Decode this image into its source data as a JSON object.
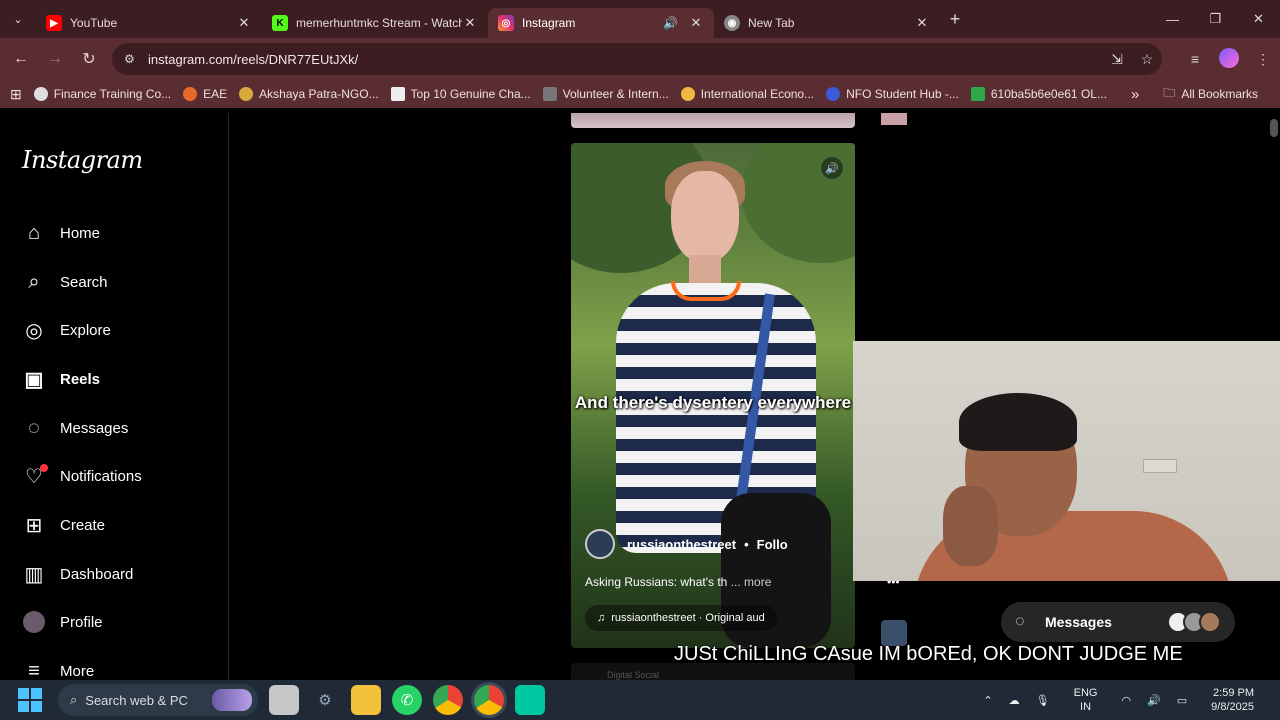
{
  "browser": {
    "tabs": [
      {
        "title": "YouTube",
        "favicon": "youtube-icon",
        "active": false
      },
      {
        "title": "memerhuntmkc Stream - Watch",
        "favicon": "kick-icon",
        "active": false
      },
      {
        "title": "Instagram",
        "favicon": "instagram-icon",
        "active": true
      },
      {
        "title": "New Tab",
        "favicon": "chrome-icon",
        "active": false
      }
    ],
    "url": "instagram.com/reels/DNR77EUtJXk/",
    "bookmarks": [
      "Finance Training Co...",
      "EAE",
      "Akshaya Patra-NGO...",
      "Top 10 Genuine Cha...",
      "Volunteer & Intern...",
      "International Econo...",
      "NFO Student Hub -...",
      "610ba5b6e0e61 OL..."
    ],
    "all_bookmarks": "All Bookmarks",
    "overflow": "»"
  },
  "instagram": {
    "logo": "Instagram",
    "nav": [
      {
        "label": "Home",
        "icon": "home-icon"
      },
      {
        "label": "Search",
        "icon": "search-icon"
      },
      {
        "label": "Explore",
        "icon": "compass-icon"
      },
      {
        "label": "Reels",
        "icon": "reels-icon",
        "active": true
      },
      {
        "label": "Messages",
        "icon": "messenger-icon"
      },
      {
        "label": "Notifications",
        "icon": "heart-icon",
        "badge": true
      },
      {
        "label": "Create",
        "icon": "plus-square-icon"
      },
      {
        "label": "Dashboard",
        "icon": "dashboard-icon"
      },
      {
        "label": "Profile",
        "icon": "avatar"
      },
      {
        "label": "More",
        "icon": "menu-icon"
      }
    ],
    "reel": {
      "caption": "And there's dysentery everywhere",
      "username": "russiaonthestreet",
      "follow": "Follo",
      "description": "Asking Russians: what's th",
      "more": "... more",
      "audio": "russiaonthestreet · Original aud",
      "next_label": "Digital Social"
    },
    "messages_label": "Messages"
  },
  "overlay_text": "JUSt ChiLLInG CAsue IM bOREd, OK DONT JUDGE ME",
  "taskbar": {
    "search_placeholder": "Search web & PC",
    "language": "ENG",
    "region": "IN",
    "time": "2:59 PM",
    "date": "9/8/2025"
  },
  "colors": {
    "tabbar": "#3c1e22",
    "toolbar": "#5a2d33",
    "instagram_bg": "#000000",
    "notification_badge": "#ff3040",
    "taskbar": "#1f2a36"
  }
}
